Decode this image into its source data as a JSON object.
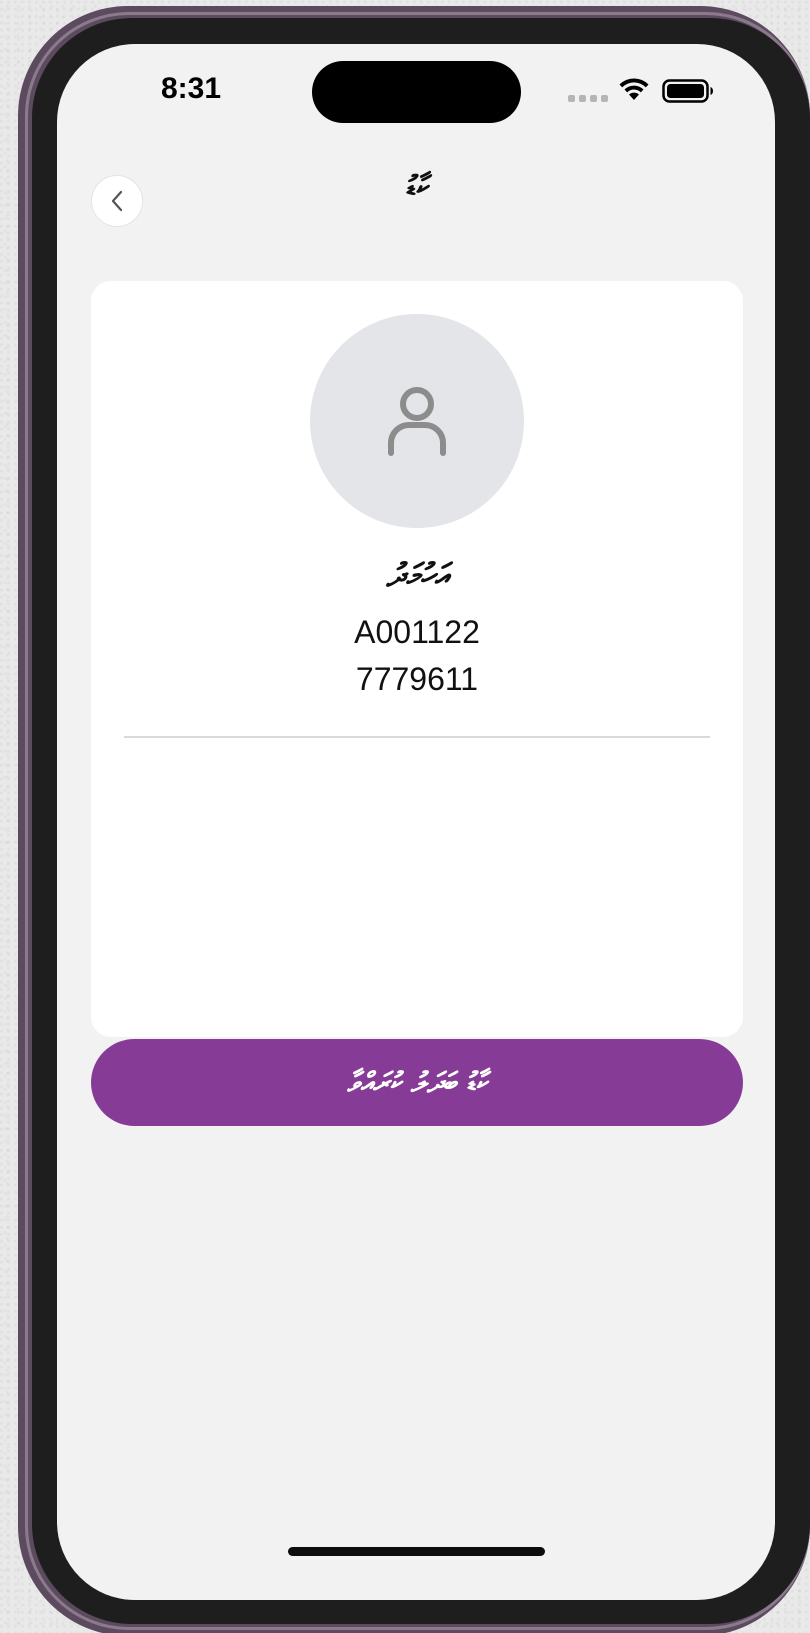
{
  "status_bar": {
    "time": "8:31",
    "icons": [
      "signal-dots-icon",
      "wifi-icon",
      "battery-icon"
    ]
  },
  "header": {
    "back_icon": "chevron-left-icon",
    "title": "ކާޑު"
  },
  "profile": {
    "avatar_icon": "user-icon",
    "name": "އަހުމަދު",
    "id_number": "A001122",
    "phone": "7779611"
  },
  "actions": {
    "primary_label": "ކާޑު ބަދަލު ކުރައްވާ"
  },
  "colors": {
    "accent": "#863c96",
    "screen_background": "#f2f2f3",
    "card_background": "#ffffff",
    "avatar_background": "#e4e5e8",
    "frame": "#5c4a5f"
  }
}
